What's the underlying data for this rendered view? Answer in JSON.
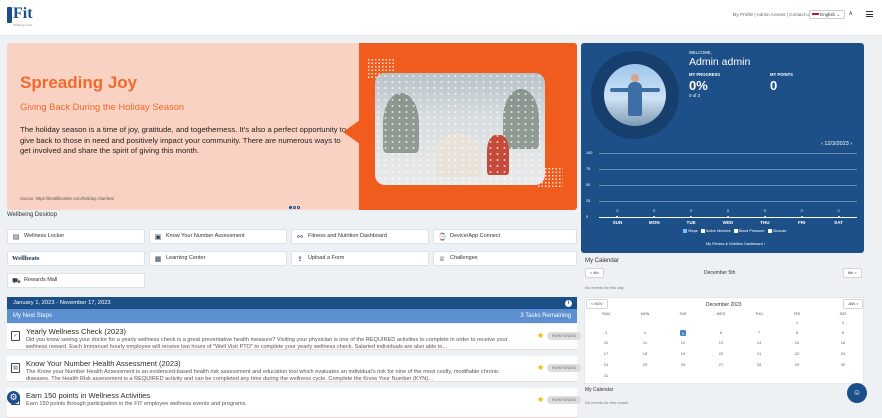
{
  "header": {
    "logo_text": "Fit",
    "logo_tagline": "Wellbeing for Life",
    "links": "My Profile | Admin Access | Contact Us | Log Out",
    "language": "English",
    "text_size": "A"
  },
  "hero": {
    "title": "Spreading Joy",
    "subtitle": "Giving Back During the Holiday Season",
    "body": "The holiday season is a time of joy, gratitude, and togetherness. It's also a perfect opportunity to give back to those in need and positively impact your community. There are numerous ways to get involved and share the spirit of giving this month.",
    "source": "Source: https://bestlifeonline.com/holiday-charities/"
  },
  "wellbeing": {
    "title": "Wellbeing Desktop",
    "tiles": [
      {
        "label": "Wellness Locker",
        "icon": "locker-icon"
      },
      {
        "label": "Know Your Number Assessment",
        "icon": "clipboard-icon"
      },
      {
        "label": "Fitness and Nutrition Dashboard",
        "icon": "dumbbell-icon"
      },
      {
        "label": "Device/App Connect",
        "icon": "watch-icon"
      },
      {
        "label": "Learning Center",
        "icon": "learning-icon"
      },
      {
        "label": "Upload a Form",
        "icon": "upload-icon"
      },
      {
        "label": "Challenges",
        "icon": "trophy-icon"
      },
      {
        "label": "Rewards Mall",
        "icon": "cart-icon"
      }
    ],
    "wellbeats": {
      "brand": "Wellbeats",
      "label": "Wellbeats"
    }
  },
  "tasks": {
    "range": "January 1, 2023 - November 17, 2023",
    "section": "My Next Steps",
    "remaining": "3 Tasks Remaining",
    "badge": "EVENT ENDED",
    "items": [
      {
        "title": "Yearly Wellness Check (2023)",
        "desc": "Did you know seeing your doctor for a yearly wellness check is a great preventative health measure? Visiting your physician is one of the REQUIRED activities to complete in order to receive your wellness reward. Each Immanuel hourly employee will receive two hours of \"Well Visit PTO\" to complete your yearly wellness check. Salaried individuals are also able to..."
      },
      {
        "title": "Know Your Number Health Assessment (2023)",
        "desc": "The Know your Number Health Assessment is an evidenced-based health risk assessment and education tool which evaluates an individual's risk for nine of the most costly, modifiable chronic diseases. The Health Risk assessment is a REQUIRED activity and can be completed any time during the wellness cycle. Complete the Know Your Number (KYN)..."
      },
      {
        "title": "Earn 150 points in Wellness Activities",
        "desc": "Earn 150 points through participation in the FIT employee wellness events and programs."
      }
    ]
  },
  "profile": {
    "welcome": "WELCOME,",
    "name": "Admin admin",
    "progress_label": "MY PROGRESS",
    "progress_value": "0%",
    "progress_detail": "0 of 3",
    "points_label": "MY POINTS",
    "points_value": "0",
    "date_nav": "12/3/2023",
    "dashboard_link": "My Fitness & Nutrition Dashboard"
  },
  "chart_data": {
    "type": "line",
    "categories": [
      "SUN",
      "MON",
      "TUE",
      "WED",
      "THU",
      "FRI",
      "SAT"
    ],
    "series": [
      {
        "name": "Steps",
        "values": [
          0,
          0,
          0,
          0,
          0,
          0,
          0
        ]
      }
    ],
    "y_ticks": [
      "100",
      "75",
      "50",
      "25",
      "0"
    ],
    "ylim": [
      0,
      100
    ],
    "legend": [
      "Steps",
      "Active Minutes",
      "Blood Pressure",
      "Glucose"
    ],
    "legend_placement": "bottom"
  },
  "calendar": {
    "title": "My Calendar",
    "prev": "< 4th",
    "next": "6th >",
    "day_title": "December 5th",
    "no_events_day": "No events for this day.",
    "month_prev": "< NOV",
    "month_next": "JAN >",
    "month_title": "December 2023",
    "weekdays": [
      "SUN",
      "MON",
      "TUE",
      "WED",
      "THU",
      "FRI",
      "SAT"
    ],
    "days": [
      "1",
      "2",
      "3",
      "4",
      "5",
      "6",
      "7",
      "8",
      "9",
      "10",
      "11",
      "12",
      "13",
      "14",
      "15",
      "16",
      "17",
      "18",
      "19",
      "20",
      "21",
      "22",
      "23",
      "24",
      "25",
      "26",
      "27",
      "28",
      "29",
      "30",
      "31"
    ],
    "today": "5",
    "title2": "My Calendar",
    "no_events_month": "No events for this month."
  }
}
